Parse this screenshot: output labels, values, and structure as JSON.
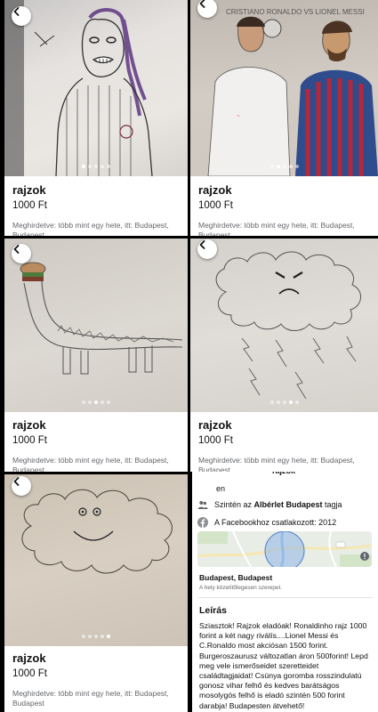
{
  "listings": [
    {
      "title": "rajzok",
      "price": "1000 Ft",
      "meta": "Meghirdetve: több mint egy hete, itt: Budapest, Budapest",
      "active_dot": 0,
      "dot_count": 5
    },
    {
      "title": "rajzok",
      "price": "1000 Ft",
      "meta": "Meghirdetve: több mint egy hete, itt: Budapest, Budapest",
      "active_dot": 1,
      "dot_count": 5,
      "image_caption": "CRISTIANO RONALDO VS LIONEL MESSI"
    },
    {
      "title": "rajzok",
      "price": "1000 Ft",
      "meta": "Meghirdetve: több mint egy hete, itt: Budapest, Budapest",
      "active_dot": 2,
      "dot_count": 5
    },
    {
      "title": "rajzok",
      "price": "1000 Ft",
      "meta": "Meghirdetve: több mint egy hete, itt: Budapest, Budapest",
      "active_dot": 3,
      "dot_count": 5
    },
    {
      "title": "rajzok",
      "price": "1000 Ft",
      "meta": "Meghirdetve: több mint egy hete, itt: Budapest, Budapest",
      "active_dot": 4,
      "dot_count": 5
    }
  ],
  "detail": {
    "seller_name": "rajzok",
    "lang": "en",
    "group_prefix": "Szintén az ",
    "group_name": "Albérlet Budapest",
    "group_suffix": " tagja",
    "joined": "A Facebookhoz csatlakozott: 2012",
    "location": "Budapest, Budapest",
    "location_note": "A hely közelítőlegesen szerepel.",
    "description_heading": "Leírás",
    "description": "Sziasztok! Rajzok eladóak! Ronaldinho rajz 1000 forint a két nagy riválís....Lionel Messi és C.Ronaldo most akciósan 1500 forint. Burgeroszaurusz változatlan áron 500forint! Lepd meg vele ismerőseidet szeretteidet családtagjaidat! Csúnya goromba rosszindulatú gonosz vihar felhő és kedves barátságos mosolygós felhő is eladó szintén 500 forint darabja! Budapesten átvehető!"
  },
  "colors": {
    "paper": "#d9d3c9",
    "background": "#000000",
    "text": "#111111",
    "muted": "#65676b",
    "map_circle": "#8fb5e8"
  },
  "icons": [
    "back-arrow-icon",
    "people-icon",
    "facebook-icon",
    "map-pin-icon"
  ]
}
